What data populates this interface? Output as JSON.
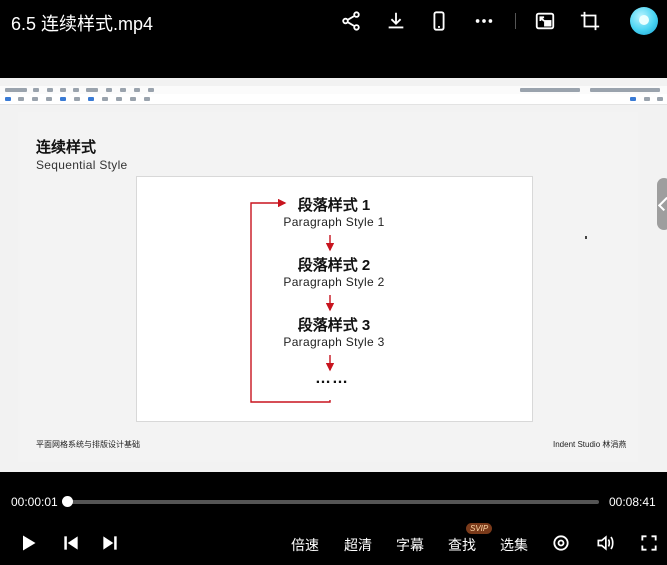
{
  "header": {
    "title": "6.5 连续样式.mp4",
    "icons": [
      "share-icon",
      "download-icon",
      "phone-icon",
      "more-icon",
      "picture-in-picture-icon",
      "crop-icon",
      "avatar"
    ]
  },
  "slide": {
    "title": "连续样式",
    "subtitle": "Sequential Style",
    "items": [
      {
        "zh": "段落样式 1",
        "en": "Paragraph Style 1"
      },
      {
        "zh": "段落样式 2",
        "en": "Paragraph Style 2"
      },
      {
        "zh": "段落样式 3",
        "en": "Paragraph Style 3"
      }
    ],
    "ellipsis": "……",
    "footer_left": "平面网格系统与排版设计基础",
    "footer_right": "Indent Studio 林涓燕",
    "accent_color": "#c8141e"
  },
  "player": {
    "current_time": "00:00:01",
    "total_time": "00:08:41",
    "progress": 0.002,
    "buttons": {
      "speed": "倍速",
      "quality": "超清",
      "subtitles": "字幕",
      "search": "查找",
      "episodes": "选集"
    },
    "badge": "SVIP"
  }
}
